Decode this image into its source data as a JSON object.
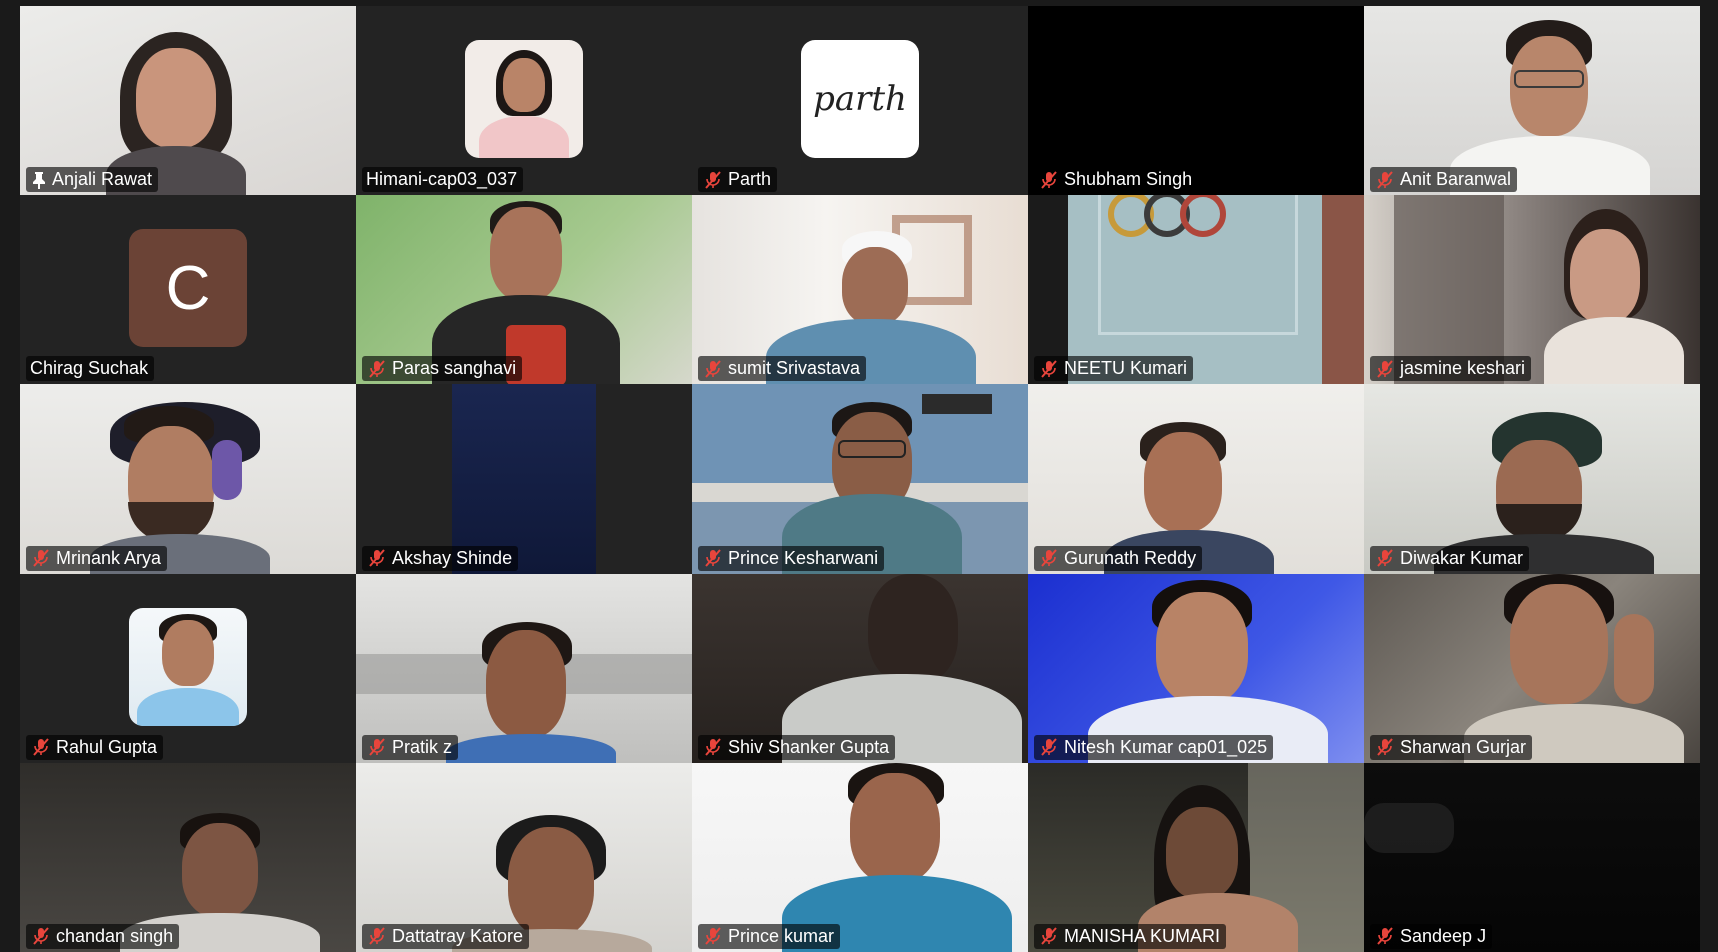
{
  "meeting": {
    "view": "gallery",
    "colors": {
      "active_speaker_border": "#2ed573",
      "muted_icon": "#e8453c",
      "tile_background": "#232323"
    }
  },
  "participants": [
    {
      "name": "Anjali Rawat",
      "muted": false,
      "pinned": true,
      "video": "camera"
    },
    {
      "name": "Himani-cap03_037",
      "muted": false,
      "pinned": false,
      "video": "profile-photo"
    },
    {
      "name": "Parth",
      "muted": true,
      "pinned": false,
      "video": "profile-logo",
      "logo_text": "parth"
    },
    {
      "name": "Shubham Singh",
      "muted": true,
      "pinned": false,
      "video": "off"
    },
    {
      "name": "Anit Baranwal",
      "muted": true,
      "pinned": false,
      "video": "camera"
    },
    {
      "name": "Chirag Suchak",
      "muted": false,
      "pinned": false,
      "video": "avatar-letter",
      "initial": "C",
      "avatar_color": "#6b4336",
      "active_speaker": true
    },
    {
      "name": "Paras sanghavi",
      "muted": true,
      "pinned": false,
      "video": "camera"
    },
    {
      "name": "sumit Srivastava",
      "muted": true,
      "pinned": false,
      "video": "camera"
    },
    {
      "name": "NEETU Kumari",
      "muted": true,
      "pinned": false,
      "video": "camera"
    },
    {
      "name": "jasmine keshari",
      "muted": true,
      "pinned": false,
      "video": "camera"
    },
    {
      "name": "Mrinank Arya",
      "muted": true,
      "pinned": false,
      "video": "camera"
    },
    {
      "name": "Akshay Shinde",
      "muted": true,
      "pinned": false,
      "video": "camera"
    },
    {
      "name": "Prince Kesharwani",
      "muted": true,
      "pinned": false,
      "video": "camera"
    },
    {
      "name": "Gurunath Reddy",
      "muted": true,
      "pinned": false,
      "video": "camera"
    },
    {
      "name": "Diwakar Kumar",
      "muted": true,
      "pinned": false,
      "video": "camera"
    },
    {
      "name": "Rahul Gupta",
      "muted": true,
      "pinned": false,
      "video": "profile-photo"
    },
    {
      "name": "Pratik z",
      "muted": true,
      "pinned": false,
      "video": "camera"
    },
    {
      "name": "Shiv Shanker Gupta",
      "muted": true,
      "pinned": false,
      "video": "camera"
    },
    {
      "name": "Nitesh Kumar cap01_025",
      "muted": true,
      "pinned": false,
      "video": "camera"
    },
    {
      "name": "Sharwan Gurjar",
      "muted": true,
      "pinned": false,
      "video": "camera"
    },
    {
      "name": "chandan singh",
      "muted": true,
      "pinned": false,
      "video": "camera"
    },
    {
      "name": "Dattatray Katore",
      "muted": true,
      "pinned": false,
      "video": "camera"
    },
    {
      "name": "Prince kumar",
      "muted": true,
      "pinned": false,
      "video": "camera"
    },
    {
      "name": "MANISHA KUMARI",
      "muted": true,
      "pinned": false,
      "video": "camera"
    },
    {
      "name": "Sandeep J",
      "muted": true,
      "pinned": false,
      "video": "camera"
    }
  ]
}
